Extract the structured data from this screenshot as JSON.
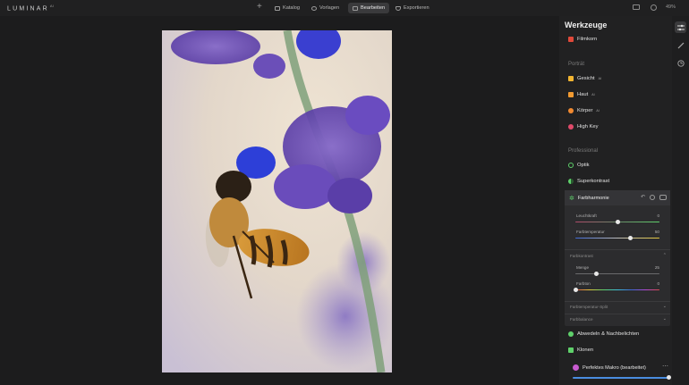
{
  "app": {
    "logo": "LUMINAR",
    "version": "AI"
  },
  "nav": {
    "tabs": [
      {
        "label": "Katalog",
        "icon": "catalog-icon"
      },
      {
        "label": "Vorlagen",
        "icon": "templates-icon"
      },
      {
        "label": "Bearbeiten",
        "icon": "edit-icon"
      },
      {
        "label": "Exportieren",
        "icon": "export-icon"
      }
    ],
    "active_tab": "Bearbeiten",
    "zoom": "49%"
  },
  "panel": {
    "title": "Werkzeuge",
    "top_tool": {
      "label": "Filmkorn",
      "color": "#e0493a"
    },
    "sections": [
      {
        "title": "Porträt",
        "tools": [
          {
            "label": "Gesicht",
            "badge": "AI",
            "color": "#f2b531"
          },
          {
            "label": "Haut",
            "badge": "AI",
            "color": "#f29a31"
          },
          {
            "label": "Körper",
            "badge": "AI",
            "color": "#f28a31"
          },
          {
            "label": "High Key",
            "badge": "",
            "color": "#e04a6a"
          }
        ]
      },
      {
        "title": "Professional",
        "tools": [
          {
            "label": "Optik",
            "badge": "",
            "color": "#5fd16b"
          },
          {
            "label": "Superkontrast",
            "badge": "",
            "color": "#5fd16b"
          }
        ]
      }
    ],
    "expanded_tool": {
      "label": "Farbharmonie",
      "color": "#5fd16b",
      "sliders_top": [
        {
          "label": "Leuchtkraft",
          "value": "0",
          "fraction": 0.5
        },
        {
          "label": "Farbtemperatur",
          "value": "50",
          "fraction": 0.65
        }
      ],
      "subsections": [
        {
          "title": "Farbkontrast",
          "sliders": [
            {
              "label": "Menge",
              "value": "25",
              "fraction": 0.25
            },
            {
              "label": "Farbton",
              "value": "0",
              "fraction": 0.0
            }
          ]
        },
        {
          "title": "Farbtemperatur-Split"
        },
        {
          "title": "Farbbalance"
        }
      ]
    },
    "bottom_tools": [
      {
        "label": "Abwedeln & Nachbelichten",
        "color": "#5fd16b"
      },
      {
        "label": "Klonen",
        "color": "#5fd16b"
      }
    ],
    "preset": {
      "name": "Perfektes Makro (bearbeitet)",
      "amount_fraction": 1.0
    }
  }
}
